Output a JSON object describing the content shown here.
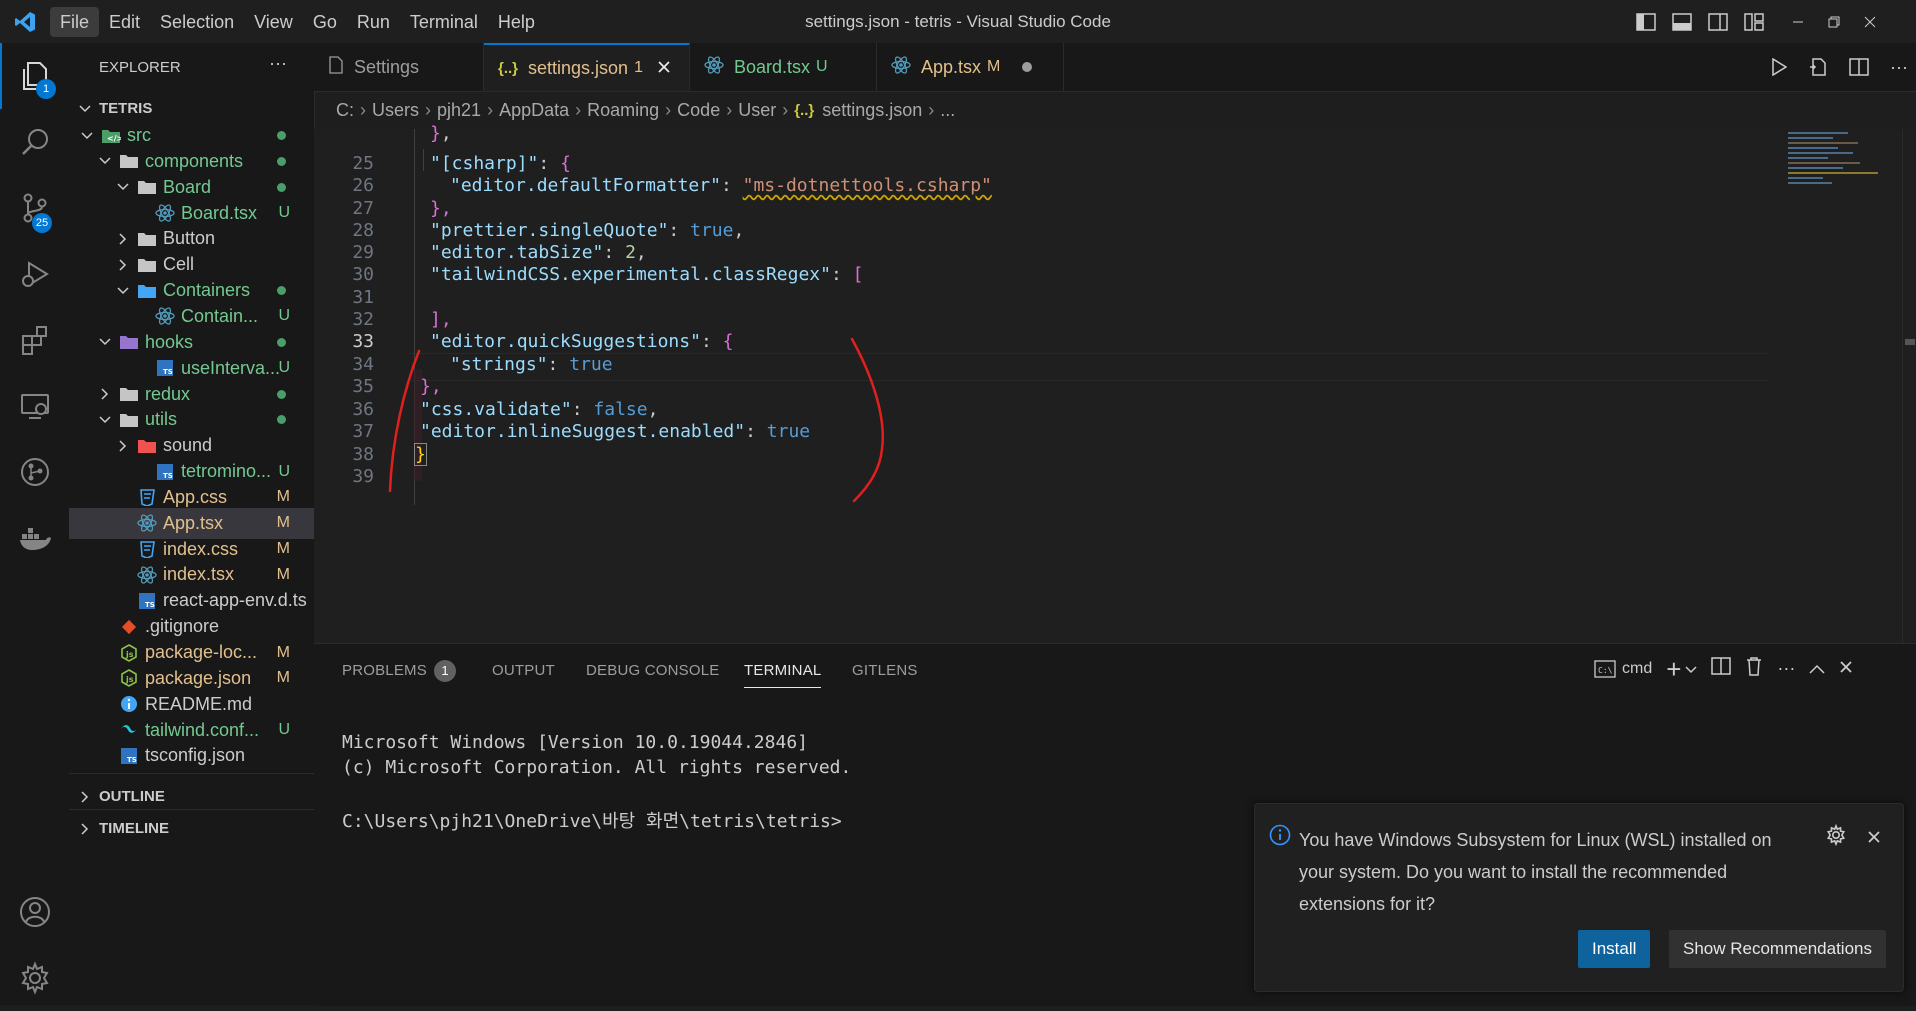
{
  "window": {
    "title": "settings.json - tetris - Visual Studio Code"
  },
  "menu": [
    "File",
    "Edit",
    "Selection",
    "View",
    "Go",
    "Run",
    "Terminal",
    "Help"
  ],
  "activity": {
    "explorer_badge": "1",
    "scm_badge": "25"
  },
  "explorer": {
    "header": "EXPLORER",
    "more": "···",
    "root": "TETRIS",
    "rows": [
      {
        "label": "src",
        "status": ""
      },
      {
        "label": "components",
        "status": ""
      },
      {
        "label": "Board",
        "status": ""
      },
      {
        "label": "Board.tsx",
        "status": "U"
      },
      {
        "label": "Button",
        "status": ""
      },
      {
        "label": "Cell",
        "status": ""
      },
      {
        "label": "Containers",
        "status": ""
      },
      {
        "label": "Contain...",
        "status": "U"
      },
      {
        "label": "hooks",
        "status": ""
      },
      {
        "label": "useInterva...",
        "status": "U"
      },
      {
        "label": "redux",
        "status": ""
      },
      {
        "label": "utils",
        "status": ""
      },
      {
        "label": "sound",
        "status": ""
      },
      {
        "label": "tetromino...",
        "status": "U"
      },
      {
        "label": "App.css",
        "status": "M"
      },
      {
        "label": "App.tsx",
        "status": "M"
      },
      {
        "label": "index.css",
        "status": "M"
      },
      {
        "label": "index.tsx",
        "status": "M"
      },
      {
        "label": "react-app-env.d.ts",
        "status": ""
      },
      {
        "label": ".gitignore",
        "status": ""
      },
      {
        "label": "package-loc...",
        "status": "M"
      },
      {
        "label": "package.json",
        "status": "M"
      },
      {
        "label": "README.md",
        "status": ""
      },
      {
        "label": "tailwind.conf...",
        "status": "U"
      },
      {
        "label": "tsconfig.json",
        "status": ""
      }
    ],
    "outline": "OUTLINE",
    "timeline": "TIMELINE"
  },
  "tabs": [
    {
      "label": "Settings",
      "flag": ""
    },
    {
      "label": "settings.json",
      "flag": "1"
    },
    {
      "label": "Board.tsx",
      "flag": "U"
    },
    {
      "label": "App.tsx",
      "flag": "M"
    }
  ],
  "breadcrumb": [
    "C:",
    "Users",
    "pjh21",
    "AppData",
    "Roaming",
    "Code",
    "User",
    "settings.json",
    "..."
  ],
  "editor": {
    "line_numbers": [
      "25",
      "26",
      "27",
      "28",
      "29",
      "30",
      "31",
      "32",
      "33",
      "34",
      "35",
      "36",
      "37",
      "38",
      "39"
    ],
    "current_line": "33",
    "lines": {
      "l25_key": "\"[csharp]\"",
      "l25_rest": ": {",
      "l26_key": "\"editor.defaultFormatter\"",
      "l26_colon": ": ",
      "l26_val": "\"ms-dotnettools.csharp\"",
      "l27": "},",
      "l28_key": "\"prettier.singleQuote\"",
      "l28_colon": ": ",
      "l28_val": "true",
      "l28_end": ",",
      "l29_key": "\"editor.tabSize\"",
      "l29_colon": ": ",
      "l29_val": "2",
      "l29_end": ",",
      "l30_key": "\"tailwindCSS.experimental.classRegex\"",
      "l30_colon": ": ",
      "l30_val": "[",
      "l32": "],",
      "l33_key": "\"editor.quickSuggestions\"",
      "l33_colon": ": ",
      "l33_val": "{",
      "l34_key": "\"strings\"",
      "l34_colon": ": ",
      "l34_val": "true",
      "l35": "},",
      "l36_key": "\"css.validate\"",
      "l36_colon": ": ",
      "l36_val": "false",
      "l36_end": ",",
      "l37_key": "\"editor.inlineSuggest.enabled\"",
      "l37_colon": ": ",
      "l37_val": "true",
      "l38": "}"
    }
  },
  "panel": {
    "tabs": [
      "PROBLEMS",
      "OUTPUT",
      "DEBUG CONSOLE",
      "TERMINAL",
      "GITLENS"
    ],
    "problems_count": "1",
    "terminal_name": "cmd",
    "terminal_lines": [
      "Microsoft Windows [Version 10.0.19044.2846]",
      "(c) Microsoft Corporation. All rights reserved.",
      "",
      "C:\\Users\\pjh21\\OneDrive\\바탕 화면\\tetris\\tetris>"
    ]
  },
  "notification": {
    "message_1": "You have Windows Subsystem for Linux (WSL) installed on",
    "message_2": "your system. Do you want to install the recommended",
    "message_3": "extensions for it?",
    "install": "Install",
    "show_recommendations": "Show Recommendations"
  }
}
